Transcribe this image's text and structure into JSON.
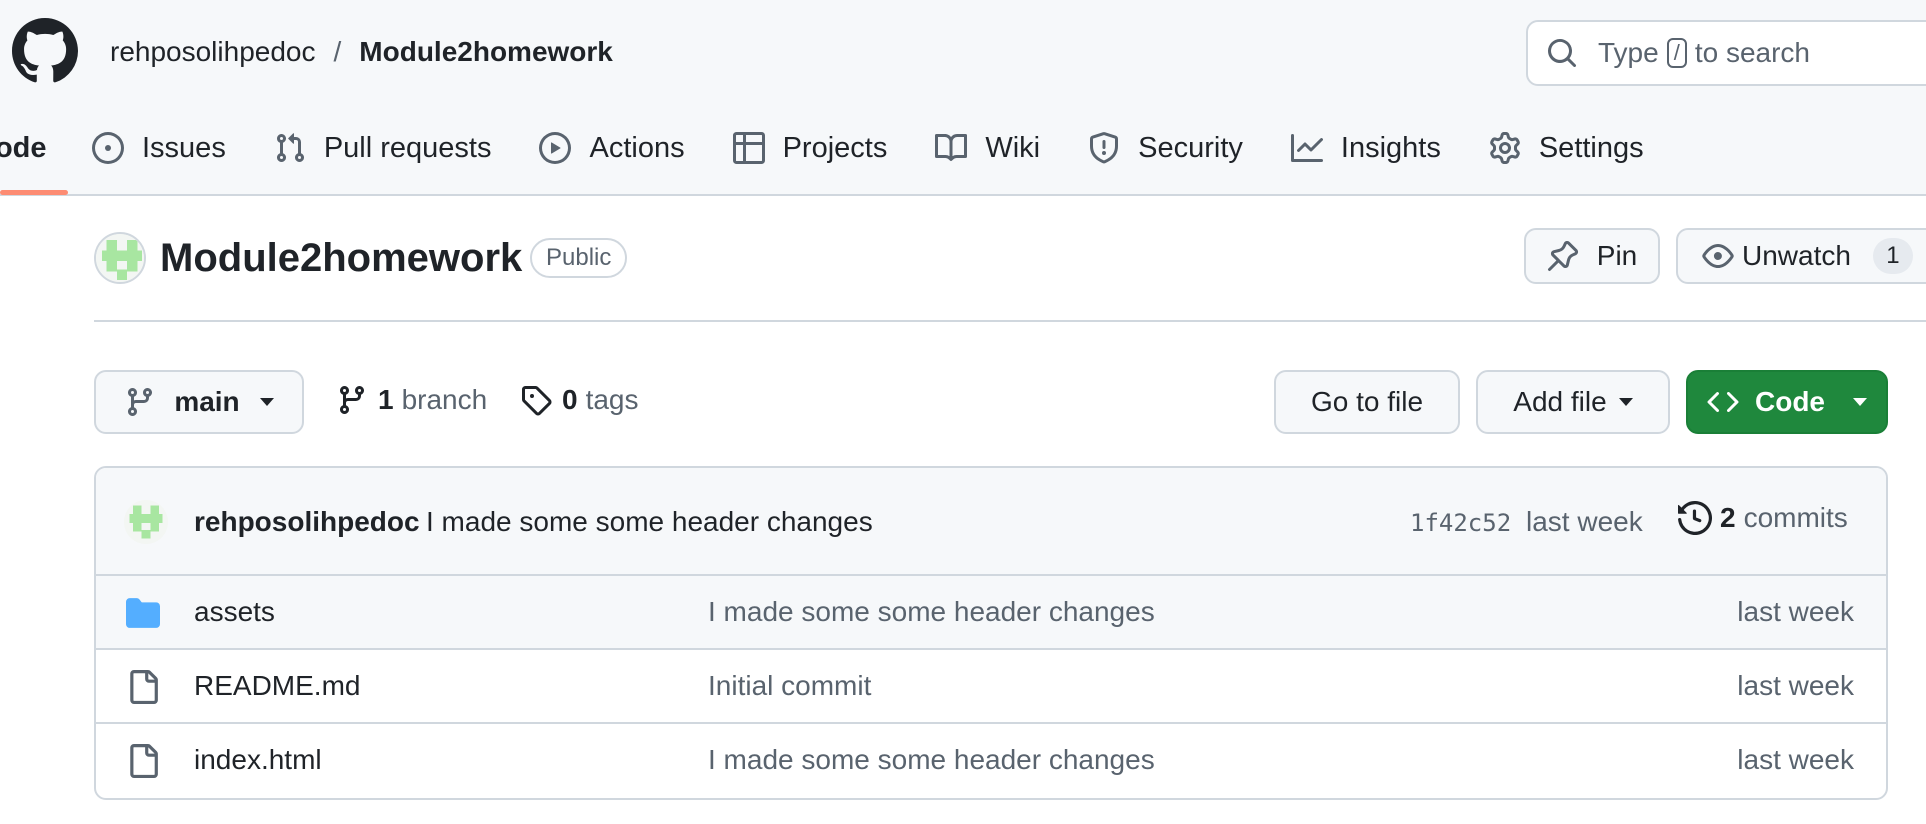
{
  "header": {
    "owner": "rehposolihpedoc",
    "separator": "/",
    "repo": "Module2homework",
    "search": {
      "text_before": "Type",
      "key": "/",
      "text_after": "to search"
    }
  },
  "tabs": [
    {
      "label": "Code",
      "icon": "code-icon",
      "selected": true
    },
    {
      "label": "Issues",
      "icon": "issue-opened-icon"
    },
    {
      "label": "Pull requests",
      "icon": "git-pull-request-icon"
    },
    {
      "label": "Actions",
      "icon": "play-icon"
    },
    {
      "label": "Projects",
      "icon": "table-icon"
    },
    {
      "label": "Wiki",
      "icon": "book-icon"
    },
    {
      "label": "Security",
      "icon": "shield-icon"
    },
    {
      "label": "Insights",
      "icon": "graph-icon"
    },
    {
      "label": "Settings",
      "icon": "gear-icon"
    }
  ],
  "repo": {
    "title": "Module2homework",
    "visibility": "Public",
    "pin_label": "Pin",
    "watch_label": "Unwatch",
    "watch_count": "1"
  },
  "branch_bar": {
    "branch": "main",
    "branches_count": "1",
    "branches_label": "branch",
    "tags_count": "0",
    "tags_label": "tags",
    "goto_label": "Go to file",
    "addfile_label": "Add file",
    "code_label": "Code"
  },
  "latest_commit": {
    "author": "rehposolihpedoc",
    "message": "I made some some header changes",
    "sha": "1f42c52",
    "time": "last week",
    "commits_count": "2",
    "commits_label": "commits"
  },
  "files": [
    {
      "name": "assets",
      "type": "folder",
      "icon": "folder-icon",
      "message": "I made some some header changes",
      "time": "last week"
    },
    {
      "name": "README.md",
      "type": "file",
      "icon": "file-icon",
      "message": "Initial commit",
      "time": "last week"
    },
    {
      "name": "index.html",
      "type": "file",
      "icon": "file-icon",
      "message": "I made some some header changes",
      "time": "last week"
    }
  ],
  "colors": {
    "accent_underline": "#fd8c73",
    "code_button": "#1f883d",
    "folder": "#54aeff",
    "avatar": "#a8e6a1"
  }
}
